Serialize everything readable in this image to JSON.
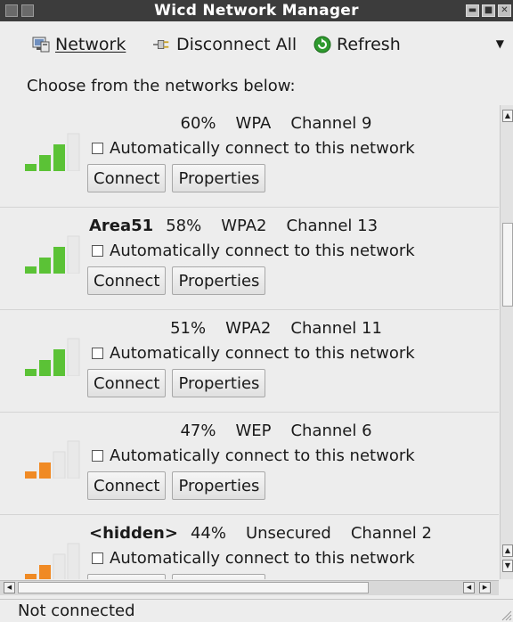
{
  "window": {
    "title": "Wicd Network Manager"
  },
  "toolbar": {
    "network_label": "Network",
    "disconnect_label": "Disconnect All",
    "refresh_label": "Refresh"
  },
  "prompt": "Choose from the networks below:",
  "networks": [
    {
      "essid": "",
      "strength": "60%",
      "encryption": "WPA",
      "channel": "Channel 9",
      "bars": 3,
      "color": "#5bc236",
      "auto_label": "Automatically connect to this network",
      "connect_label": "Connect",
      "properties_label": "Properties"
    },
    {
      "essid": "Area51",
      "strength": "58%",
      "encryption": "WPA2",
      "channel": "Channel 13",
      "bars": 3,
      "color": "#5bc236",
      "auto_label": "Automatically connect to this network",
      "connect_label": "Connect",
      "properties_label": "Properties"
    },
    {
      "essid": "",
      "strength": "51%",
      "encryption": "WPA2",
      "channel": "Channel 11",
      "bars": 3,
      "color": "#5bc236",
      "auto_label": "Automatically connect to this network",
      "connect_label": "Connect",
      "properties_label": "Properties"
    },
    {
      "essid": "",
      "strength": "47%",
      "encryption": "WEP",
      "channel": "Channel 6",
      "bars": 2,
      "color": "#f08a24",
      "auto_label": "Automatically connect to this network",
      "connect_label": "Connect",
      "properties_label": "Properties"
    },
    {
      "essid": "<hidden>",
      "strength": "44%",
      "encryption": "Unsecured",
      "channel": "Channel 2",
      "bars": 2,
      "color": "#f08a24",
      "auto_label": "Automatically connect to this network",
      "connect_label": "Connect",
      "properties_label": "Properties"
    }
  ],
  "status": {
    "text": "Not connected"
  },
  "colors": {
    "titlebar": "#3c3c3c",
    "signal_good": "#5bc236",
    "signal_fair": "#f08a24",
    "refresh_icon": "#2e9a2e"
  }
}
